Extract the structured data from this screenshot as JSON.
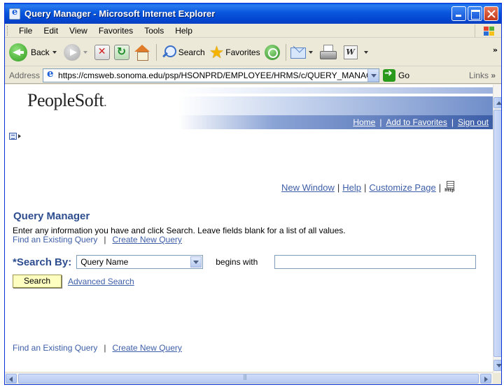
{
  "window": {
    "title": "Query Manager - Microsoft Internet Explorer"
  },
  "menubar": {
    "items": [
      "File",
      "Edit",
      "View",
      "Favorites",
      "Tools",
      "Help"
    ]
  },
  "toolbar": {
    "back_label": "Back",
    "search_label": "Search",
    "favorites_label": "Favorites",
    "more": "»"
  },
  "addressbar": {
    "label": "Address",
    "url": "https://cmsweb.sonoma.edu/psp/HSONPRD/EMPLOYEE/HRMS/c/QUERY_MANAGE",
    "go_label": "Go",
    "links_label": "Links",
    "links_more": "»"
  },
  "peoplesoft": {
    "logo": "PeopleSoft",
    "nav": [
      "Home",
      "Add to Favorites",
      "Sign out"
    ]
  },
  "pagelinks": {
    "new_window": "New Window",
    "help": "Help",
    "customize": "Customize Page"
  },
  "page": {
    "title": "Query Manager",
    "instructions": "Enter any information you have and click Search. Leave fields blank for a list of all values.",
    "find_existing": "Find an Existing Query",
    "create_new": "Create New Query",
    "search_by_label": "*Search By:",
    "search_by_value": "Query Name",
    "begins_with": "begins with",
    "search_input_value": "",
    "search_button": "Search",
    "advanced_search": "Advanced Search"
  },
  "colors": {
    "titlebar": "#0a5fe4",
    "peoplesoft_blue": "#2e4e8f",
    "link": "#3d5ea8",
    "search_button": "#fefec0"
  }
}
